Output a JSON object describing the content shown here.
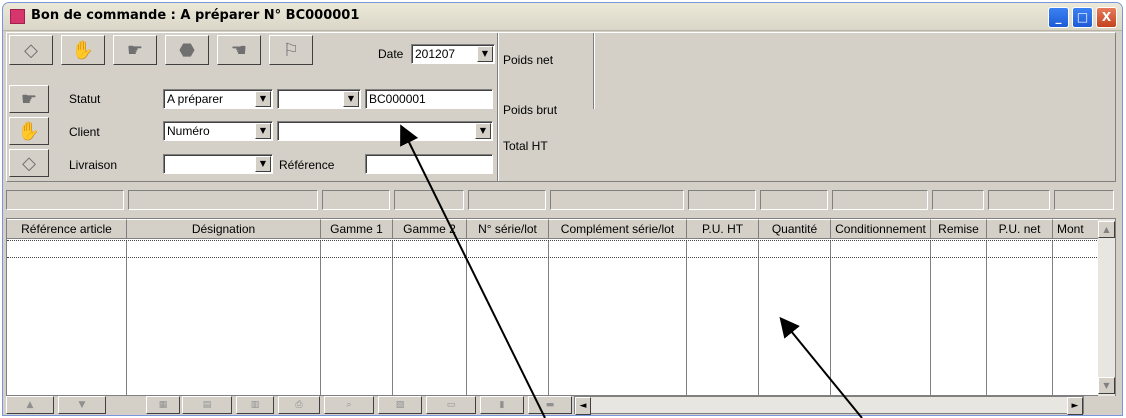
{
  "window": {
    "title": "Bon de commande : A préparer N° BC000001",
    "controls": [
      "_",
      "□",
      "X"
    ]
  },
  "toolbar": {
    "icons": [
      "card-icon",
      "hand-icon",
      "hand2-icon",
      "stop-icon",
      "pointer-icon",
      "bell-icon"
    ]
  },
  "form": {
    "date_label": "Date",
    "date_value": "201207",
    "statut_label": "Statut",
    "statut_value": "A préparer",
    "statut_value2": "",
    "numero_value": "BC000001",
    "client_label": "Client",
    "client_type": "Numéro",
    "client_value": "",
    "livraison_label": "Livraison",
    "livraison_value": "",
    "reference_label": "Référence",
    "reference_value": ""
  },
  "totals": {
    "poids_net_label": "Poids net",
    "poids_brut_label": "Poids brut",
    "total_ht_label": "Total HT"
  },
  "grid": {
    "columns": [
      "Référence article",
      "Désignation",
      "Gamme 1",
      "Gamme 2",
      "N° série/lot",
      "Complément série/lot",
      "P.U. HT",
      "Quantité",
      "Conditionnement",
      "Remise",
      "P.U. net",
      "Mont"
    ]
  },
  "bottom": {
    "buttons": [
      "▲",
      "▼",
      "▦",
      "▤",
      "▥",
      "⎙",
      "⌕",
      "▧",
      "▭",
      "▮",
      "▬"
    ],
    "scroll_left": "◄",
    "scroll_right": "►"
  }
}
